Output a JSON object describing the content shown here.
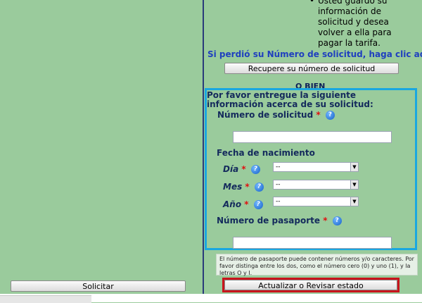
{
  "bullet_text": "Usted guardó su información de solicitud y desea volver a ella para pagar la tarifa.",
  "bullet_lines": [
    "Usted guardó su",
    "información de",
    "solicitud y desea",
    "volver a ella para",
    "pagar la tarifa."
  ],
  "lost_number_text": "Si perdió su Número de solicitud, haga clic aquí:",
  "recover_button": "Recupere su número de solicitud",
  "or_label": "O BIEN",
  "form": {
    "intro": "Por favor entregue la siguiente información acerca de su solicitud:",
    "application_number_label": "Número de solicitud",
    "application_number_value": "",
    "birth_date_label": "Fecha de nacimiento",
    "day_label": "Día",
    "month_label": "Mes",
    "year_label": "Año",
    "day_value": "--",
    "month_value": "--",
    "year_value": "--",
    "passport_label": "Número de pasaporte",
    "passport_value": "",
    "required_mark": "*",
    "help_glyph": "?"
  },
  "passport_note": "El número de pasaporte puede contener números y/o caracteres. Por favor distinga entre los dos, como el número cero (0) y uno (1), y la letras O y I.",
  "update_button": "Actualizar o Revisar estado",
  "submit_button": "Solicitar",
  "colors": {
    "background": "#9acb9c",
    "highlight_box": "#1aa7e0",
    "focus_box": "#c9141c",
    "required": "#e01010",
    "link": "#1f3fbf"
  },
  "icons": [
    "help-icon",
    "dropdown-arrow-icon"
  ]
}
